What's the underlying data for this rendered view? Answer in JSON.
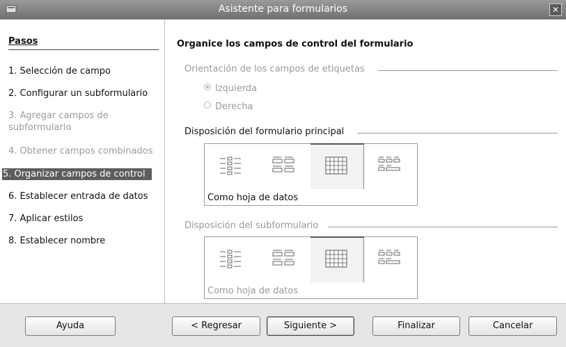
{
  "window": {
    "title": "Asistente para formularios",
    "close_glyph": "✕"
  },
  "steps": {
    "header": "Pasos",
    "items": [
      {
        "label": "1. Selección de campo",
        "state": "normal"
      },
      {
        "label": "2. Configurar un subformulario",
        "state": "normal"
      },
      {
        "label": "3. Agregar campos de subformulario",
        "state": "disabled"
      },
      {
        "label": "4. Obtener campos combinados",
        "state": "disabled"
      },
      {
        "label": "5. Organizar campos de control",
        "state": "active"
      },
      {
        "label": "6. Establecer entrada de datos",
        "state": "normal"
      },
      {
        "label": "7. Aplicar estilos",
        "state": "normal"
      },
      {
        "label": "8. Establecer nombre",
        "state": "normal"
      }
    ]
  },
  "main": {
    "heading": "Organice los campos de control del formulario",
    "label_orientation": {
      "title": "Orientación de los campos de etiquetas",
      "options": [
        {
          "label": "Izquierda",
          "checked": true
        },
        {
          "label": "Derecha",
          "checked": false
        }
      ]
    },
    "main_layout": {
      "title": "Disposición del formulario principal",
      "caption": "Como hoja de datos",
      "options": [
        "columnar-left-labels",
        "columnar-top-labels",
        "datasheet",
        "block-top-labels"
      ],
      "selected": "datasheet"
    },
    "sub_layout": {
      "title": "Disposición del subformulario",
      "caption": "Como hoja de datos",
      "options": [
        "columnar-left-labels",
        "columnar-top-labels",
        "datasheet",
        "block-top-labels"
      ],
      "selected": "datasheet"
    }
  },
  "buttons": {
    "help": "Ayuda",
    "back": "< Regresar",
    "next": "Siguiente >",
    "finish": "Finalizar",
    "cancel": "Cancelar"
  }
}
